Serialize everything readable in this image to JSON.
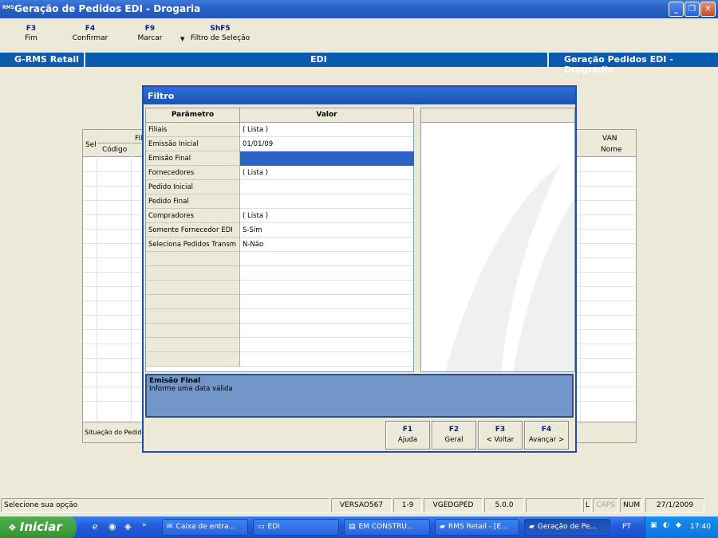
{
  "window": {
    "app_icon": "RMS",
    "title": "Geração de Pedidos EDI - Drogaria"
  },
  "toolbar": [
    {
      "key": "F3",
      "label": "Fim"
    },
    {
      "key": "F4",
      "label": "Confirmar"
    },
    {
      "key": "F9",
      "label": "Marcar"
    },
    {
      "key": "ShF5",
      "label": "Filtro de Seleção"
    }
  ],
  "band": {
    "left": "G-RMS Retail",
    "center": "EDI",
    "right": "Geração Pedidos EDI - Drogradia"
  },
  "background_grid": {
    "col_sel": "Sel",
    "col_fil": "Fil",
    "col_codigo": "Código",
    "col_van": "VAN",
    "col_nome": "Nome",
    "footer_text": "Situação do Pedido :"
  },
  "dialog": {
    "title": "Filtro",
    "headers": {
      "param": "Parâmetro",
      "value": "Valor"
    },
    "rows": [
      {
        "name": "Filiais",
        "value": "( Lista )"
      },
      {
        "name": "Emissão Inicial",
        "value": "01/01/09"
      },
      {
        "name": "Emisão Final",
        "value": ""
      },
      {
        "name": "Fornecedores",
        "value": "( Lista )"
      },
      {
        "name": "Pedido Inicial",
        "value": ""
      },
      {
        "name": "Pedido Final",
        "value": ""
      },
      {
        "name": "Compradores",
        "value": "( Lista )"
      },
      {
        "name": "Somente Fornecedor EDI",
        "value": "S-Sim"
      },
      {
        "name": "Seleciona Pedidos Transm",
        "value": "N-Não"
      }
    ],
    "help": {
      "title": "Emisão Final",
      "text": "Informe uma data válida"
    },
    "buttons": [
      {
        "key": "F1",
        "label": "Ajuda"
      },
      {
        "key": "F2",
        "label": "Geral"
      },
      {
        "key": "F3",
        "label": "< Voltar"
      },
      {
        "key": "F4",
        "label": "Avançar >"
      }
    ]
  },
  "status": {
    "message": "Selecione sua opção",
    "version": "VERSAO567",
    "range": "1-9",
    "program": "VGEDGPED",
    "build": "5.0.0",
    "l": "L",
    "caps": "CAPS",
    "num": "NUM",
    "date": "27/1/2009"
  },
  "taskbar": {
    "start": "Iniciar",
    "tasks": [
      "Caixa de entra...",
      "EDI",
      "EM CONSTRU...",
      "RMS Retail - [E...",
      "Geração de Pe..."
    ],
    "lang": "PT",
    "time": "17:40"
  }
}
